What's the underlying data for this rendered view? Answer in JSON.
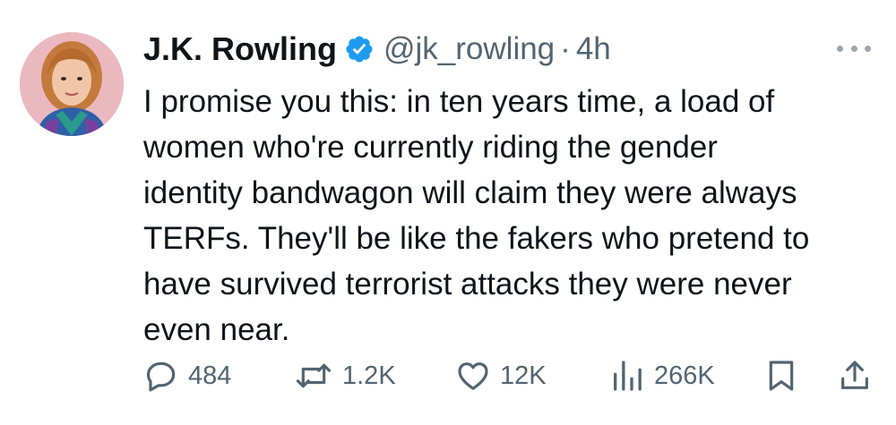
{
  "tweet": {
    "author_name": "J.K. Rowling",
    "handle": "@jk_rowling",
    "separator": "·",
    "time": "4h",
    "verified_color": "#1d9bf0",
    "text_lines": [
      "I promise you this: in ten years time, a load of",
      "women who're currently riding the gender",
      "identity bandwagon will claim they were always",
      "TERFs. They'll be like the fakers who pretend to",
      "have survived terrorist attacks they were never",
      "even near."
    ]
  },
  "actions": {
    "replies": "484",
    "reposts": "1.2K",
    "likes": "12K",
    "views": "266K"
  },
  "icons": [
    "verified-badge-icon",
    "more-options-icon",
    "reply-icon",
    "repost-icon",
    "like-icon",
    "views-icon",
    "bookmark-icon",
    "share-icon"
  ]
}
